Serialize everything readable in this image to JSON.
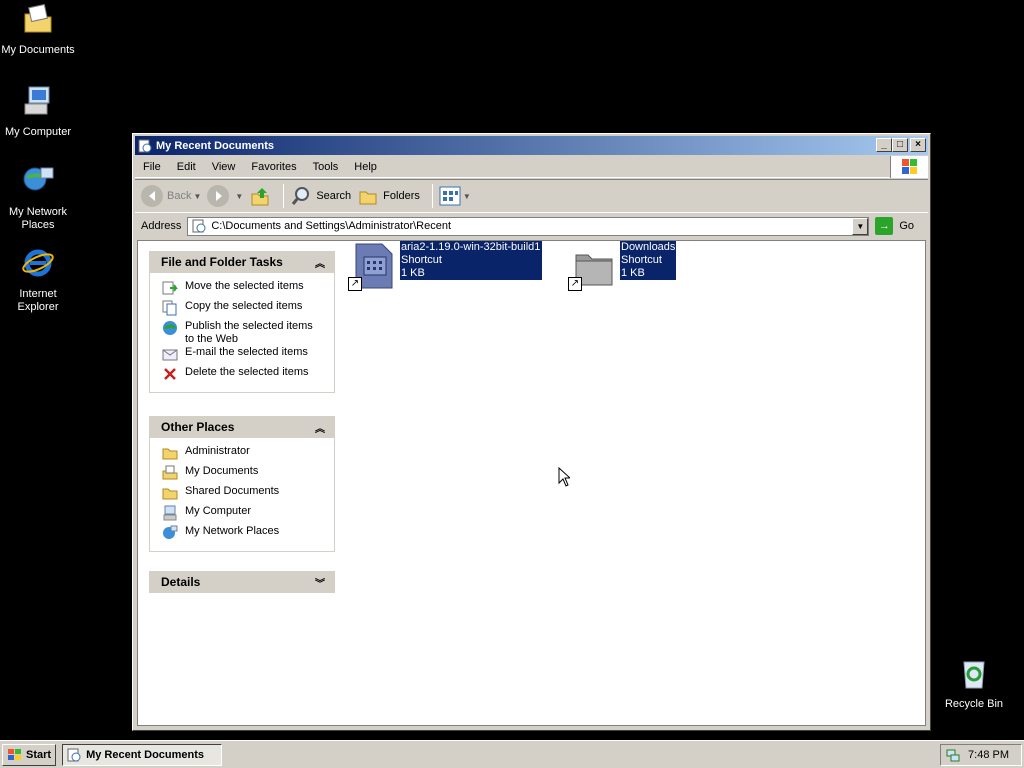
{
  "desktop": {
    "icons": [
      {
        "label": "My Documents",
        "icon": "my-documents-icon"
      },
      {
        "label": "My Computer",
        "icon": "my-computer-icon"
      },
      {
        "label": "My Network Places",
        "icon": "network-places-icon"
      },
      {
        "label": "Internet Explorer",
        "icon": "internet-explorer-icon"
      },
      {
        "label": "Recycle Bin",
        "icon": "recycle-bin-icon"
      }
    ]
  },
  "window": {
    "title": "My Recent Documents",
    "menu": [
      "File",
      "Edit",
      "View",
      "Favorites",
      "Tools",
      "Help"
    ],
    "toolbar": {
      "back": "Back",
      "search": "Search",
      "folders": "Folders"
    },
    "address": {
      "label": "Address",
      "value": "C:\\Documents and Settings\\Administrator\\Recent",
      "go": "Go"
    },
    "panels": {
      "tasks": {
        "title": "File and Folder Tasks",
        "items": [
          {
            "label": "Move the selected items",
            "icon": "move-icon"
          },
          {
            "label": "Copy the selected items",
            "icon": "copy-icon"
          },
          {
            "label": "Publish the selected items to the Web",
            "icon": "publish-web-icon"
          },
          {
            "label": "E-mail the selected items",
            "icon": "email-icon"
          },
          {
            "label": "Delete the selected items",
            "icon": "delete-icon"
          }
        ]
      },
      "places": {
        "title": "Other Places",
        "items": [
          {
            "label": "Administrator",
            "icon": "folder-icon"
          },
          {
            "label": "My Documents",
            "icon": "my-documents-icon"
          },
          {
            "label": "Shared Documents",
            "icon": "folder-icon"
          },
          {
            "label": "My Computer",
            "icon": "my-computer-icon"
          },
          {
            "label": "My Network Places",
            "icon": "network-places-icon"
          }
        ]
      },
      "details": {
        "title": "Details"
      }
    },
    "files": [
      {
        "name": "aria2-1.19.0-win-32bit-build1",
        "type": "Shortcut",
        "size": "1 KB",
        "selected": true
      },
      {
        "name": "Downloads",
        "type": "Shortcut",
        "size": "1 KB",
        "selected": true
      }
    ]
  },
  "taskbar": {
    "start": "Start",
    "task": "My Recent Documents",
    "clock": "7:48 PM"
  },
  "colors": {
    "titlebar": "#0a246a",
    "selection": "#0a246a",
    "window_face": "#d4d0c8",
    "desktop": "#000000"
  }
}
